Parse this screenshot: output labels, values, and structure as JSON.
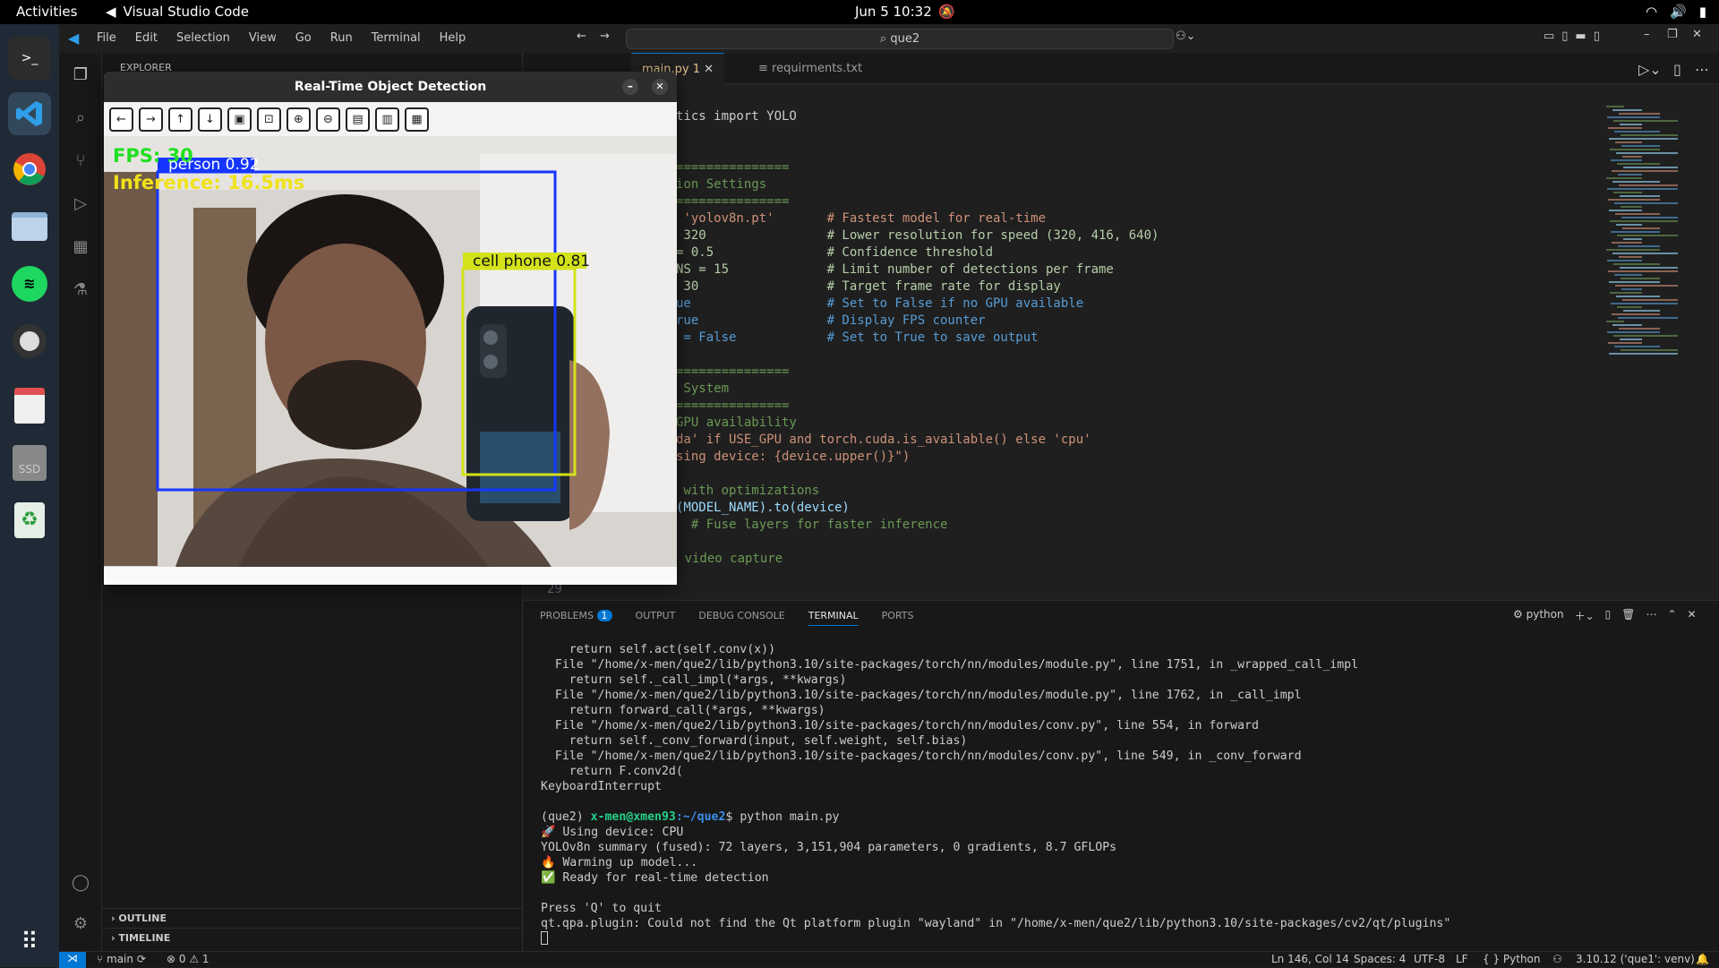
{
  "topbar": {
    "activities": "Activities",
    "app": "Visual Studio Code",
    "clock": "Jun 5  10:32"
  },
  "dock": [
    "terminal-icon",
    "vscode-icon",
    "chrome-icon",
    "files-icon",
    "spotify-icon",
    "camera-icon",
    "text-editor-icon",
    "ssd-drive-icon",
    "recycle-bin-icon",
    "apps-grid-icon"
  ],
  "vscode": {
    "menu": [
      "File",
      "Edit",
      "Selection",
      "View",
      "Go",
      "Run",
      "Terminal",
      "Help"
    ],
    "search": "que2",
    "sidebar": {
      "header": "EXPLORER",
      "outline": "OUTLINE",
      "timeline": "TIMELINE"
    },
    "tabs": [
      {
        "label": "main.py",
        "badge": "1"
      },
      {
        "label": "requirments.txt"
      }
    ],
    "code": [
      {
        "t": "tics import YOLO",
        "c": "#ccc"
      },
      {
        "t": "",
        "c": "#ccc"
      },
      {
        "t": "",
        "c": "#ccc"
      },
      {
        "t": "===============",
        "c": "#6a9955"
      },
      {
        "t": "ion Settings",
        "c": "#6a9955"
      },
      {
        "t": "===============",
        "c": "#6a9955"
      },
      {
        "t": " 'yolov8n.pt'       # Fastest model for real-time",
        "c": "#ce9178"
      },
      {
        "t": " 320                # Lower resolution for speed (320, 416, 640)",
        "c": "#b5cea8"
      },
      {
        "t": "= 0.5               # Confidence threshold",
        "c": "#b5cea8"
      },
      {
        "t": "NS = 15             # Limit number of detections per frame",
        "c": "#b5cea8"
      },
      {
        "t": " 30                 # Target frame rate for display",
        "c": "#b5cea8"
      },
      {
        "t": "ue                  # Set to False if no GPU available",
        "c": "#569cd6"
      },
      {
        "t": "rue                 # Display FPS counter",
        "c": "#569cd6"
      },
      {
        "t": " = False            # Set to True to save output",
        "c": "#569cd6"
      },
      {
        "t": "",
        "c": "#ccc"
      },
      {
        "t": "===============",
        "c": "#6a9955"
      },
      {
        "t": " System",
        "c": "#6a9955"
      },
      {
        "t": "===============",
        "c": "#6a9955"
      },
      {
        "t": "GPU availability",
        "c": "#6a9955"
      },
      {
        "t": "da' if USE_GPU and torch.cuda.is_available() else 'cpu'",
        "c": "#ce9178"
      },
      {
        "t": "sing device: {device.upper()}\")",
        "c": "#ce9178"
      },
      {
        "t": "",
        "c": "#ccc"
      },
      {
        "t": " with optimizations",
        "c": "#6a9955"
      },
      {
        "t": "(MODEL_NAME).to(device)",
        "c": "#9cdcfe"
      },
      {
        "t": "  # Fuse layers for faster inference",
        "c": "#6a9955"
      },
      {
        "t": "",
        "c": "#ccc"
      },
      {
        "t": "# Initialize video capture",
        "c": "#6a9955"
      }
    ],
    "lineno": "29",
    "panel_tabs": [
      {
        "label": "PROBLEMS",
        "badge": "1"
      },
      {
        "label": "OUTPUT"
      },
      {
        "label": "DEBUG CONSOLE"
      },
      {
        "label": "TERMINAL"
      },
      {
        "label": "PORTS"
      }
    ],
    "panel_shell": "python",
    "terminal": [
      "    return self.act(self.conv(x))",
      "  File \"/home/x-men/que2/lib/python3.10/site-packages/torch/nn/modules/module.py\", line 1751, in _wrapped_call_impl",
      "    return self._call_impl(*args, **kwargs)",
      "  File \"/home/x-men/que2/lib/python3.10/site-packages/torch/nn/modules/module.py\", line 1762, in _call_impl",
      "    return forward_call(*args, **kwargs)",
      "  File \"/home/x-men/que2/lib/python3.10/site-packages/torch/nn/modules/conv.py\", line 554, in forward",
      "    return self._conv_forward(input, self.weight, self.bias)",
      "  File \"/home/x-men/que2/lib/python3.10/site-packages/torch/nn/modules/conv.py\", line 549, in _conv_forward",
      "    return F.conv2d(",
      "KeyboardInterrupt",
      "",
      "(que2) x-men@xmen93:~/que2$ python main.py",
      "🚀 Using device: CPU",
      "YOLOv8n summary (fused): 72 layers, 3,151,904 parameters, 0 gradients, 8.7 GFLOPs",
      "🔥 Warming up model...",
      "✅ Ready for real-time detection",
      "",
      "Press 'Q' to quit",
      "qt.qpa.plugin: Could not find the Qt platform plugin \"wayland\" in \"/home/x-men/que2/lib/python3.10/site-packages/cv2/qt/plugins\""
    ],
    "status": {
      "branch": "main",
      "problems": "⊗ 0 ⚠ 1",
      "position": "Ln 146, Col 14",
      "spaces": "Spaces: 4",
      "encoding": "UTF-8",
      "eol": "LF",
      "language": "{ } Python",
      "interpreter": "3.10.12 ('que1': venv)"
    }
  },
  "detect_window": {
    "title": "Real-Time Object Detection",
    "fps": "FPS: 30",
    "inference": "Inference: 16.5ms",
    "box1": "person 0.92",
    "box2": "cell phone 0.81"
  }
}
